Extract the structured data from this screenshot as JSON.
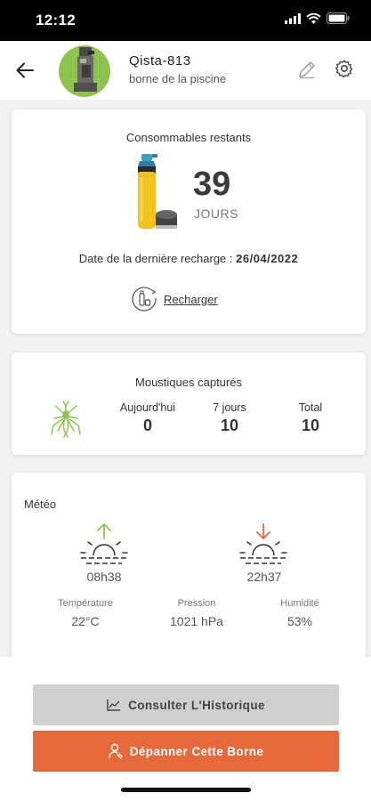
{
  "status_bar": {
    "time": "12:12"
  },
  "header": {
    "device_name": "Qista-813",
    "device_location": "borne de la piscine",
    "avatar_bg": "#8dc44e"
  },
  "consumables": {
    "title": "Consommables restants",
    "days_value": "39",
    "days_unit": "JOURS",
    "recharge_label": "Date de la dernière recharge : ",
    "recharge_date": "26/04/2022",
    "recharge_action": "Recharger"
  },
  "mosquitoes": {
    "title": "Moustiques capturés",
    "columns": [
      {
        "label": "Aujourd'hui",
        "value": "0"
      },
      {
        "label": "7 jours",
        "value": "10"
      },
      {
        "label": "Total",
        "value": "10"
      }
    ],
    "icon_color": "#8dc44e"
  },
  "weather": {
    "title": "Météo",
    "sunrise": "08h38",
    "sunset": "22h37",
    "metrics": [
      {
        "label": "Température",
        "value": "22°C"
      },
      {
        "label": "Pression",
        "value": "1021 hPa"
      },
      {
        "label": "Humidité",
        "value": "53%"
      }
    ],
    "sunrise_color": "#8dc44e",
    "sunset_color": "#e5693b"
  },
  "actions": {
    "history_label": "Consulter L'Historique",
    "repair_label": "Dépanner Cette Borne",
    "repair_color": "#e5693b"
  }
}
